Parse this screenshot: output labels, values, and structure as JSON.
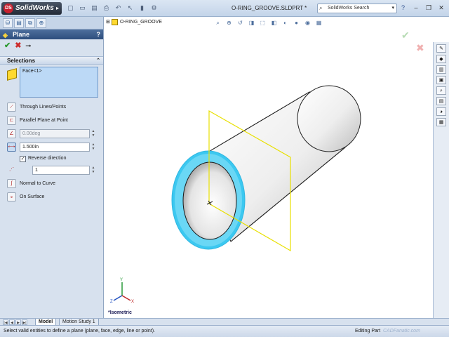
{
  "window": {
    "app_name": "SolidWorks",
    "brand_badge": "DS",
    "title": "O-RING_GROOVE.SLDPRT *",
    "search_placeholder": "SolidWorks Search"
  },
  "quick_access": [
    "new",
    "open",
    "save",
    "print",
    "undo",
    "select",
    "rebuild",
    "options"
  ],
  "feature_manager_tabs": [
    "featuremanager",
    "propertymanager",
    "configurationmanager",
    "dimxpert"
  ],
  "property_manager": {
    "title": "Plane",
    "help": "?",
    "selections_title": "Selections",
    "selection_items": [
      "Face<1>"
    ],
    "options": {
      "through_lines_points": "Through Lines/Points",
      "parallel_plane_at_point": "Parallel Plane at Point",
      "angle_value": "0.00deg",
      "offset_value": "1.500in",
      "reverse_direction": "Reverse direction",
      "reverse_direction_checked": true,
      "number_of_planes": "1",
      "normal_to_curve": "Normal to Curve",
      "on_surface": "On Surface"
    }
  },
  "graphics": {
    "tree_root": "O-RING_GROOVE",
    "view_orientation": "*Isometric",
    "colors": {
      "selected_face": "#3cc8f0",
      "plane_preview": "#e8e000",
      "body_shade": "#f2f2f2"
    }
  },
  "bottom_tabs": {
    "model": "Model",
    "motion": "Motion Study 1"
  },
  "status": {
    "message": "Select valid entities to define a plane (plane, face, edge, line or point).",
    "mode": "Editing Part",
    "watermark": "CADFanatic.com"
  }
}
